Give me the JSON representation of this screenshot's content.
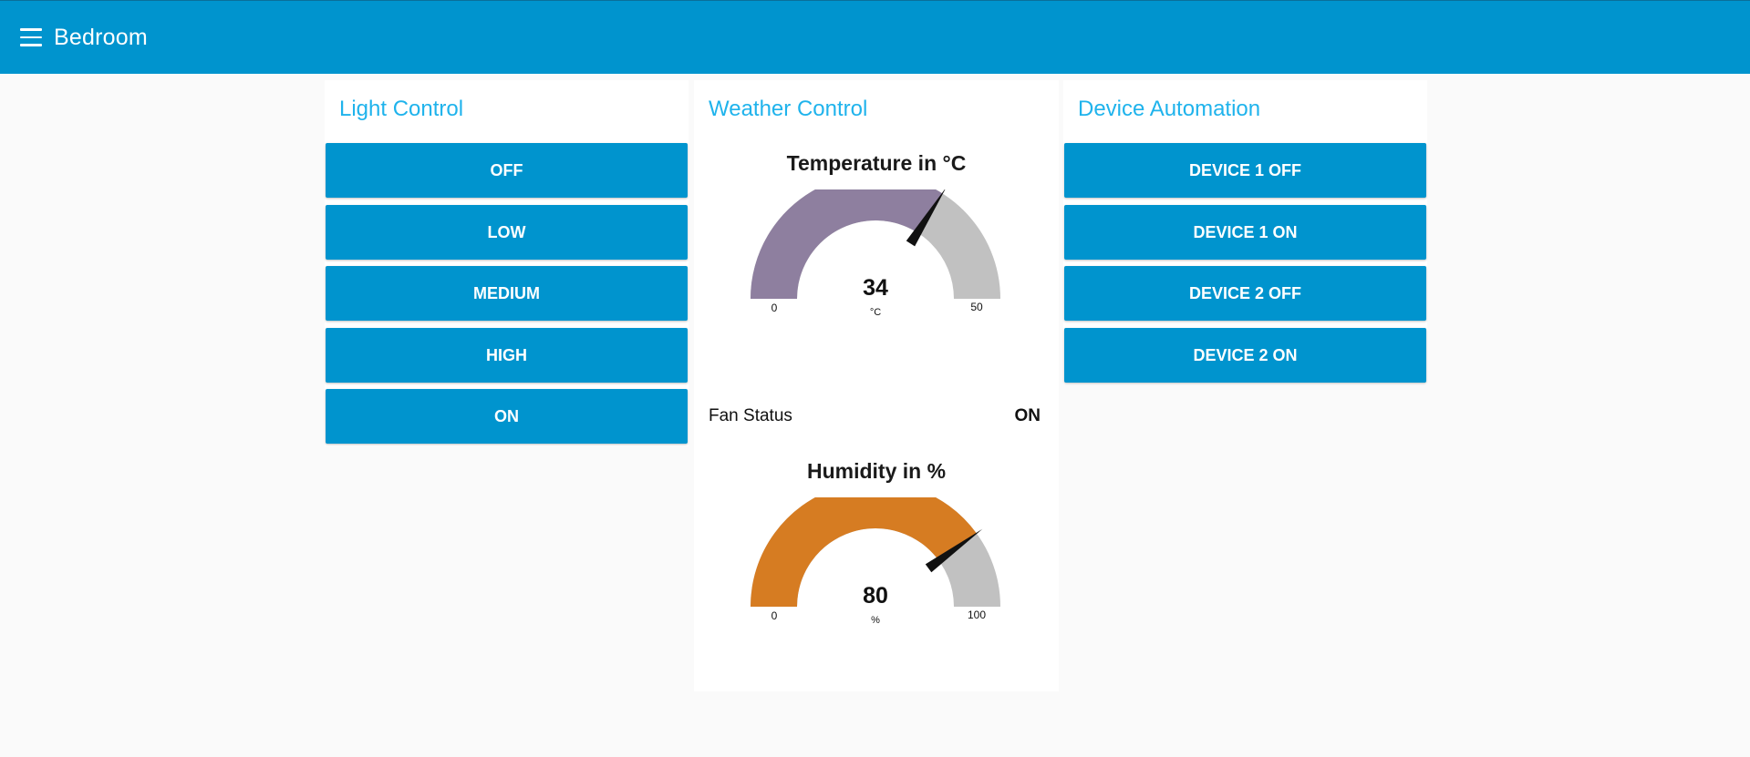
{
  "header": {
    "title": "Bedroom"
  },
  "light_control": {
    "title": "Light Control",
    "buttons": [
      "OFF",
      "LOW",
      "MEDIUM",
      "HIGH",
      "ON"
    ]
  },
  "weather_control": {
    "title": "Weather Control",
    "temperature": {
      "title": "Temperature in °C",
      "value": 34,
      "value_text": "34",
      "unit": "°C",
      "min": 0,
      "max": 50,
      "min_text": "0",
      "max_text": "50",
      "fill_color": "#8e7f9f",
      "track_color": "#c1c1c1"
    },
    "fan_status": {
      "label": "Fan Status",
      "value": "ON"
    },
    "humidity": {
      "title": "Humidity in %",
      "value": 80,
      "value_text": "80",
      "unit": "%",
      "min": 0,
      "max": 100,
      "min_text": "0",
      "max_text": "100",
      "fill_color": "#d67c22",
      "track_color": "#c1c1c1"
    }
  },
  "device_automation": {
    "title": "Device Automation",
    "buttons": [
      "DEVICE 1 OFF",
      "DEVICE 1 ON",
      "DEVICE 2 OFF",
      "DEVICE 2 ON"
    ]
  },
  "colors": {
    "accent": "#0094ce",
    "card_title": "#1fb3ec",
    "background": "#fafafa"
  },
  "icons": {
    "menu": "hamburger-menu-icon"
  }
}
